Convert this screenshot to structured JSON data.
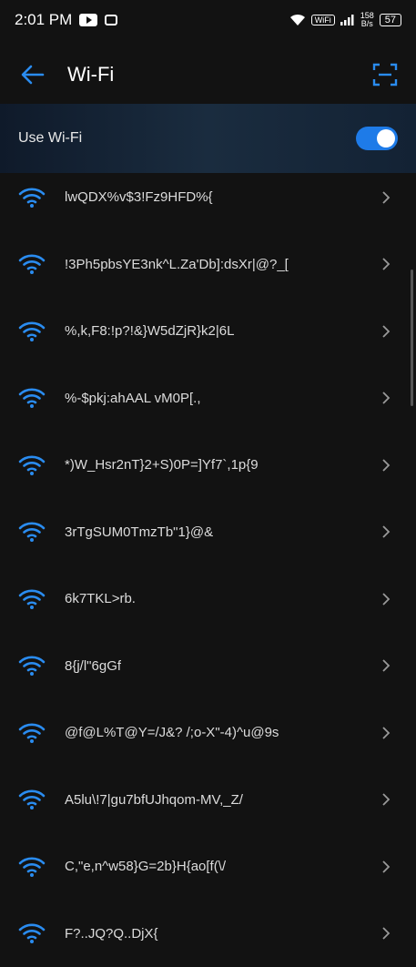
{
  "status_bar": {
    "time": "2:01 PM",
    "wifi_badge": "WiFi",
    "speed_value": "158",
    "speed_unit": "B/s",
    "battery": "57"
  },
  "header": {
    "title": "Wi-Fi",
    "back_icon": "arrow-left-icon",
    "scan_icon": "qr-scan-icon"
  },
  "wifi_toggle": {
    "label": "Use Wi-Fi",
    "enabled": true
  },
  "colors": {
    "accent": "#1e7be8",
    "background": "#121212"
  },
  "networks": [
    {
      "name": "lwQDX%v$3!Fz9HFD%{"
    },
    {
      "name": "!3Ph5pbsYE3nk^L.Za'Db]:dsXr|@?_["
    },
    {
      "name": "%,k,F8:!p?!&}W5dZjR}k2|6L"
    },
    {
      "name": "%-$pkj:ahAAL vM0P[.,"
    },
    {
      "name": "*)W_Hsr2nT}2+S)0P=]Yf7`,1p{9"
    },
    {
      "name": "3rTgSUM0TmzTb\"1}@&"
    },
    {
      "name": "6k7TKL>rb."
    },
    {
      "name": "8{j/l\"6gGf"
    },
    {
      "name": "@f@L%T@Y=/J&? /;o-X\"-4)^u@9s"
    },
    {
      "name": "A5lu\\!7|gu7bfUJhqom-MV,_Z/"
    },
    {
      "name": "C,\"e,n^w58}G=2b}H{ao[f(\\/"
    },
    {
      "name": "F?..JQ?Q..DjX{"
    }
  ]
}
